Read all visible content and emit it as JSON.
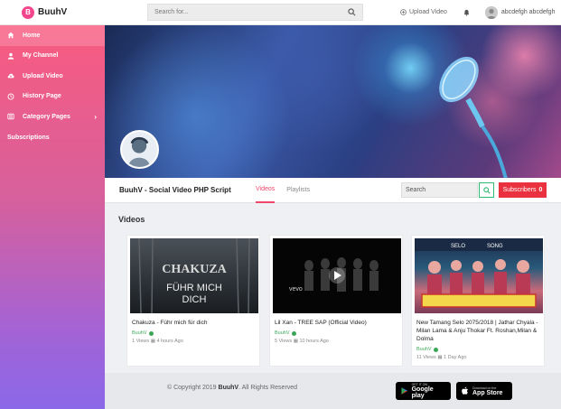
{
  "topbar": {
    "brand_initial": "B",
    "brand_name": "BuuhV",
    "search_placeholder": "Search for...",
    "upload_label": "Upload Video",
    "user_name": "abcdefgh abcdefgh"
  },
  "sidebar": {
    "items": [
      {
        "label": "Home",
        "icon": "home-icon"
      },
      {
        "label": "My Channel",
        "icon": "user-icon"
      },
      {
        "label": "Upload Video",
        "icon": "cloud-upload-icon"
      },
      {
        "label": "History Page",
        "icon": "history-icon"
      },
      {
        "label": "Category Pages",
        "icon": "list-icon"
      }
    ],
    "subscriptions_label": "Subscriptions"
  },
  "channel": {
    "title": "BuuhV - Social Video PHP Script",
    "tabs": [
      "Videos",
      "Playlists"
    ],
    "search_placeholder": "Search",
    "subscribe_label": "Subscribers",
    "subscriber_count": "0"
  },
  "videos_section": {
    "title": "Videos",
    "cards": [
      {
        "thumb_text_1": "CHAKUZA",
        "thumb_text_2": "FÜHR MICH",
        "thumb_text_3": "DICH",
        "title": "Chakuza - Führ mich für dich",
        "channel": "BuuhV",
        "views": "1 Views",
        "time": "4 hours Ago"
      },
      {
        "thumb_text_1": "vevo",
        "title": "Lil Xan - TREE SAP (Official Video)",
        "channel": "BuuhV",
        "views": "5 Views",
        "time": "10 hours Ago"
      },
      {
        "thumb_text_1": "SELO",
        "thumb_text_2": "SONG",
        "title": "New Tamang Selo 2075/2018 | Jathar Chyala - Milan Lama & Anju Thokar Ft. Roshan,Milan & Dolma",
        "channel": "BuuhV",
        "views": "11 Views",
        "time": "1 Day Ago"
      }
    ]
  },
  "footer": {
    "copyright_prefix": "© Copyright 2019",
    "copyright_brand": "BuuhV",
    "copyright_suffix": ". All Rights Reserved",
    "google_small": "GET IT ON",
    "google_big": "Google play",
    "apple_small": "Download on the",
    "apple_big": "App Store"
  },
  "colors": {
    "accent": "#f0466b",
    "subscribe": "#e9313f",
    "verified": "#3aa757"
  }
}
